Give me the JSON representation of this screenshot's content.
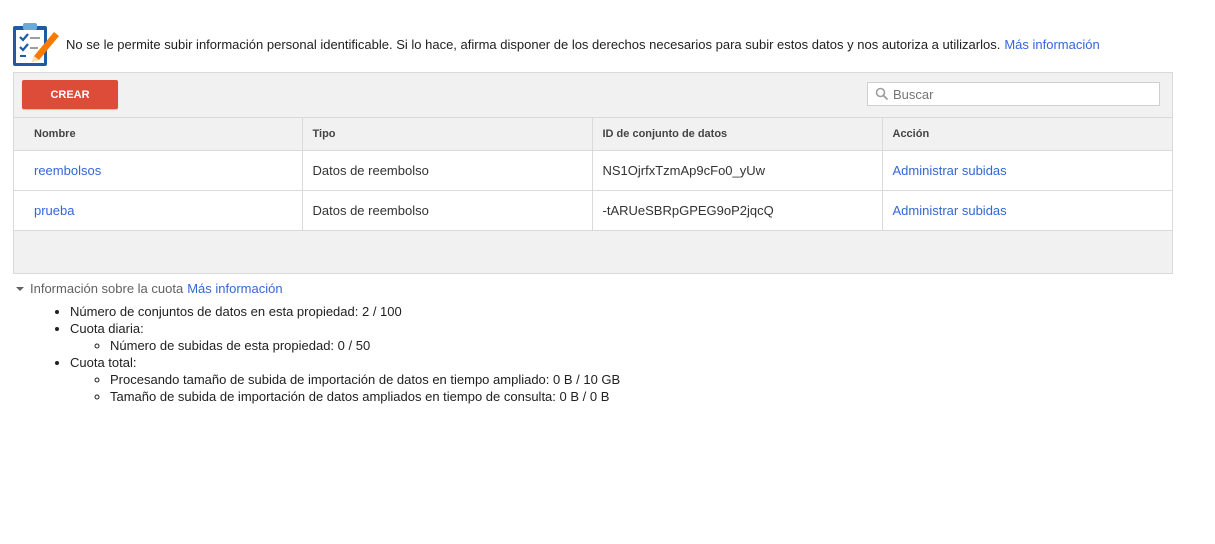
{
  "notice": {
    "icon": "clipboard-pencil-icon",
    "text": "No se le permite subir información personal identificable. Si lo hace, afirma disponer de los derechos necesarios para subir estos datos y nos autoriza a utilizarlos.",
    "link": "Más información"
  },
  "toolbar": {
    "create_label": "CREAR",
    "search_placeholder": "Buscar"
  },
  "table": {
    "headers": [
      "Nombre",
      "Tipo",
      "ID de conjunto de datos",
      "Acción"
    ],
    "rows": [
      {
        "name": "reembolsos",
        "type": "Datos de reembolso",
        "id": "NS1OjrfxTzmAp9cFo0_yUw",
        "action": "Administrar subidas"
      },
      {
        "name": "prueba",
        "type": "Datos de reembolso",
        "id": "-tARUeSBRpGPEG9oP2jqcQ",
        "action": "Administrar subidas"
      }
    ]
  },
  "quota": {
    "title": "Información sobre la cuota",
    "link": "Más información",
    "datasets": "Número de conjuntos de datos en esta propiedad: 2 / 100",
    "daily_label": "Cuota diaria:",
    "daily_uploads": "Número de subidas de esta propiedad: 0 / 50",
    "total_label": "Cuota total:",
    "total_processing": "Procesando tamaño de subida de importación de datos en tiempo ampliado: 0 B / 10 GB",
    "total_query": "Tamaño de subida de importación de datos ampliados en tiempo de consulta: 0 B / 0 B"
  },
  "colors": {
    "accent_red": "#dd4b39",
    "link_blue": "#3367d6"
  }
}
